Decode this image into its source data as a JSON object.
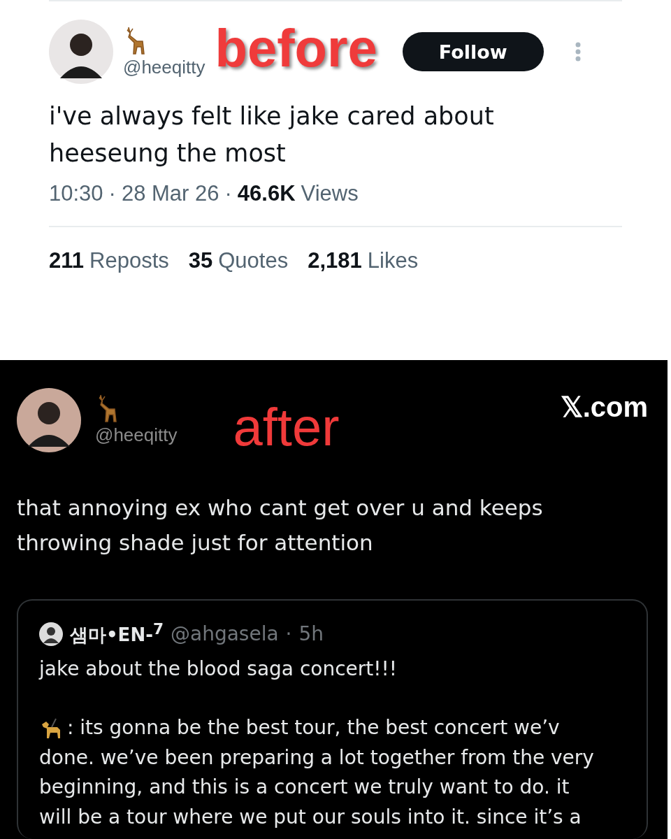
{
  "before": {
    "overlay_label": "before",
    "author": {
      "handle": "@heeqitty"
    },
    "follow_button": "Follow",
    "text": "i've always felt like jake cared about heeseung the most",
    "meta": {
      "time": "10:30",
      "separator": "·",
      "date": "28 Mar 26",
      "separator_2": "·",
      "views_count": "46.6K",
      "views_label": "Views"
    },
    "stats": [
      {
        "count": "211",
        "label": "Reposts"
      },
      {
        "count": "35",
        "label": "Quotes"
      },
      {
        "count": "2,181",
        "label": "Likes"
      }
    ]
  },
  "after": {
    "overlay_label": "after",
    "author": {
      "handle": "@heeqitty"
    },
    "site": "𝕏.com",
    "text": "that annoying ex who cant get over u and keeps throwing shade just for attention",
    "quote": {
      "display_name": "샘마•EN-$^{7}$",
      "handle": "@ahgasela",
      "separator": "·",
      "age": "5h",
      "title": "jake about the blood saga concert!!!",
      "body_first_line": ": its gonna be the best tour, the best concert we’v",
      "body": "done. we’ve been preparing a lot together from the very beginning, and this is a concert we truly want to do. it will be a tour where we put our souls into it. since it’s a"
    }
  }
}
